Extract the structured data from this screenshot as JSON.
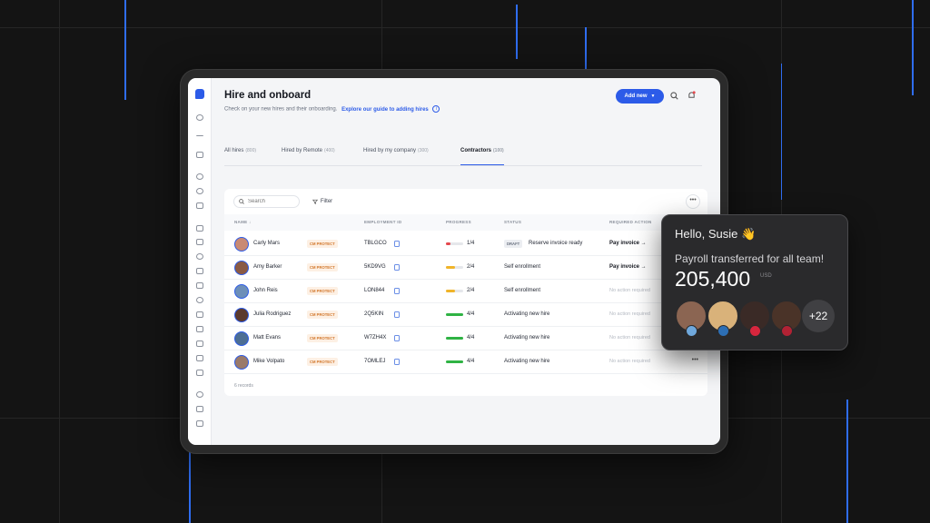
{
  "header": {
    "title": "Hire and onboard",
    "subtitle": "Check on your new hires and their onboarding.",
    "guide_link": "Explore our guide to adding hires",
    "add_new_label": "Add new"
  },
  "tabs": [
    {
      "label": "All hires",
      "count": "(800)"
    },
    {
      "label": "Hired by Remote",
      "count": "(400)"
    },
    {
      "label": "Hired by my company",
      "count": "(300)"
    },
    {
      "label": "Contractors",
      "count": "(100)"
    }
  ],
  "toolbar": {
    "search_placeholder": "Search",
    "filter_label": "Filter",
    "more_label": "•••"
  },
  "table": {
    "headers": {
      "name": "NAME ↓",
      "employment_id": "EMPLOYMENT ID",
      "progress": "PROGRESS",
      "status": "STATUS",
      "required_action": "REQUIRED ACTION"
    },
    "rows": [
      {
        "name": "Carly Mars",
        "badge": "CM PROTECT",
        "employment_id": "TBLGCO",
        "progress": "1/4",
        "progress_fraction": 0.25,
        "progress_color": "#e5484d",
        "draft": "DRAFT",
        "status": "Reserve invoice ready",
        "action": "Pay invoice →",
        "action_muted": false
      },
      {
        "name": "Amy Barker",
        "badge": "CM PROTECT",
        "employment_id": "5KD9VG",
        "progress": "2/4",
        "progress_fraction": 0.5,
        "progress_color": "#f0b429",
        "draft": "",
        "status": "Self enrollment",
        "action": "Pay invoice →",
        "action_muted": false
      },
      {
        "name": "John Reis",
        "badge": "CM PROTECT",
        "employment_id": "LON844",
        "progress": "2/4",
        "progress_fraction": 0.5,
        "progress_color": "#f0b429",
        "draft": "",
        "status": "Self enrollment",
        "action": "No action required",
        "action_muted": true
      },
      {
        "name": "Julia Rodriguez",
        "badge": "CM PROTECT",
        "employment_id": "2Q5KIN",
        "progress": "4/4",
        "progress_fraction": 1.0,
        "progress_color": "#2fb344",
        "draft": "",
        "status": "Activating new hire",
        "action": "No action required",
        "action_muted": true
      },
      {
        "name": "Matt Evans",
        "badge": "CM PROTECT",
        "employment_id": "W7ZH4X",
        "progress": "4/4",
        "progress_fraction": 1.0,
        "progress_color": "#2fb344",
        "draft": "",
        "status": "Activating new hire",
        "action": "No action required",
        "action_muted": true
      },
      {
        "name": "Mike Volpato",
        "badge": "CM PROTECT",
        "employment_id": "7OMLEJ",
        "progress": "4/4",
        "progress_fraction": 1.0,
        "progress_color": "#2fb344",
        "draft": "",
        "status": "Activating new hire",
        "action": "No action required",
        "action_muted": true
      }
    ],
    "records_label": "6 records"
  },
  "popup": {
    "greeting": "Hello, Susie 👋",
    "message": "Payroll transferred for all team!",
    "amount": "205,400",
    "currency": "USD",
    "more_count": "+22"
  },
  "colors": {
    "accent": "#2c5be8",
    "background": "#141414",
    "popup_bg": "#2a2a2c"
  }
}
